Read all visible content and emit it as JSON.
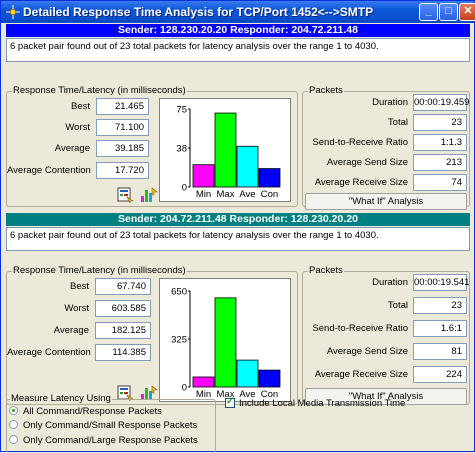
{
  "window": {
    "title": "Detailed Response Time Analysis for TCP/Port 1452<-->SMTP",
    "icons": {
      "app": "network-icon",
      "min": "minimize-icon",
      "max": "maximize-icon",
      "close": "close-icon"
    }
  },
  "section1": {
    "header": "Sender:  128.230.20.20   Responder:  204.72.211.48",
    "message": "6 packet pair found out of 23 total packets for latency analysis over the range 1 to 4030.",
    "latency": {
      "title": "Response Time/Latency (in milliseconds)",
      "best_label": "Best",
      "best": "21.465",
      "worst_label": "Worst",
      "worst": "71.100",
      "average_label": "Average",
      "average": "39.185",
      "contention_label": "Average Contention",
      "contention": "17.720"
    },
    "chart_data": {
      "type": "bar",
      "categories": [
        "Min",
        "Max",
        "Ave",
        "Con"
      ],
      "values": [
        21.465,
        71.1,
        39.185,
        17.72
      ],
      "colors": [
        "#ff00ff",
        "#00ff00",
        "#00ffff",
        "#0000ff"
      ],
      "yticks": [
        "75",
        "38",
        "0"
      ],
      "ylim": [
        0,
        75
      ]
    },
    "packets": {
      "title": "Packets",
      "duration_label": "Duration",
      "duration": "00:00:19.459",
      "total_label": "Total",
      "total": "23",
      "ratio_label": "Send-to-Receive Ratio",
      "ratio": "1:1.3",
      "send_label": "Average Send Size",
      "send": "213",
      "receive_label": "Average Receive Size",
      "receive": "74",
      "whatif": "\"What If\" Analysis"
    }
  },
  "section2": {
    "header": "Sender:  204.72.211.48   Responder:  128.230.20.20",
    "message": "6 packet pair found out of 23 total packets for latency analysis over the range 1 to 4030.",
    "latency": {
      "title": "Response Time/Latency (in milliseconds)",
      "best_label": "Best",
      "best": "67.740",
      "worst_label": "Worst",
      "worst": "603.585",
      "average_label": "Average",
      "average": "182.125",
      "contention_label": "Average Contention",
      "contention": "114.385"
    },
    "chart_data": {
      "type": "bar",
      "categories": [
        "Min",
        "Max",
        "Ave",
        "Con"
      ],
      "values": [
        67.74,
        603.585,
        182.125,
        114.385
      ],
      "colors": [
        "#ff00ff",
        "#00ff00",
        "#00ffff",
        "#0000ff"
      ],
      "yticks": [
        "650",
        "325",
        "0"
      ],
      "ylim": [
        0,
        650
      ]
    },
    "packets": {
      "title": "Packets",
      "duration_label": "Duration",
      "duration": "00:00:19.541",
      "total_label": "Total",
      "total": "23",
      "ratio_label": "Send-to-Receive Ratio",
      "ratio": "1.6:1",
      "send_label": "Average Send Size",
      "send": "81",
      "receive_label": "Average Receive Size",
      "receive": "224",
      "whatif": "\"What If\" Analysis"
    }
  },
  "measure": {
    "title": "Measure Latency Using",
    "options": [
      {
        "label": "All Command/Response Packets",
        "selected": true
      },
      {
        "label": "Only Command/Small Response Packets",
        "selected": false
      },
      {
        "label": "Only Command/Large Response Packets",
        "selected": false
      }
    ]
  },
  "include_local": {
    "label": "Include Local Media Transmission Time",
    "checked": true
  }
}
